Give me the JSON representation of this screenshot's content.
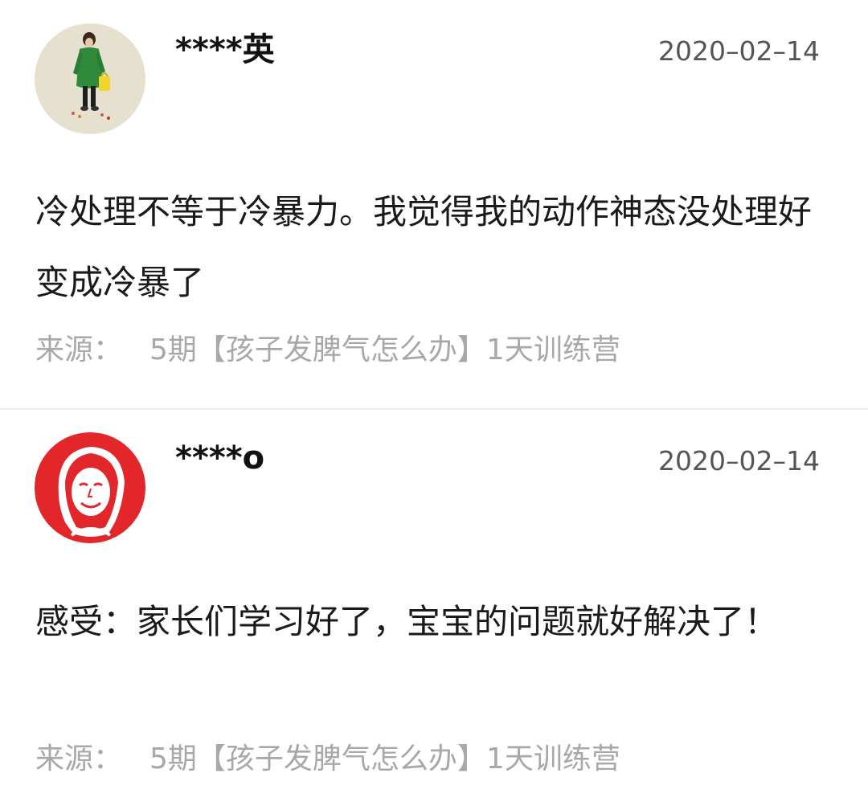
{
  "comments": [
    {
      "username": "****英",
      "date": "2020–02–14",
      "avatar_icon": "user-avatar-icon",
      "content": "冷处理不等于冷暴力。我觉得我的动作神态没处理好变成冷暴了",
      "source_label": "来源：",
      "source_text": "5期【孩子发脾气怎么办】1天训练营"
    },
    {
      "username": "****o",
      "date": "2020–02–14",
      "avatar_icon": "user-avatar-icon",
      "content": "感受：家长们学习好了，宝宝的问题就好解决了！",
      "source_label": "来源：",
      "source_text": "5期【孩子发脾气怎么办】1天训练营"
    }
  ],
  "colors": {
    "text_primary": "#1a1a1a",
    "text_secondary": "#555555",
    "text_source": "#a8a8a8",
    "divider": "#ececec",
    "avatar1_bg": "#e6e1cf",
    "avatar2_bg": "#e3262a"
  }
}
